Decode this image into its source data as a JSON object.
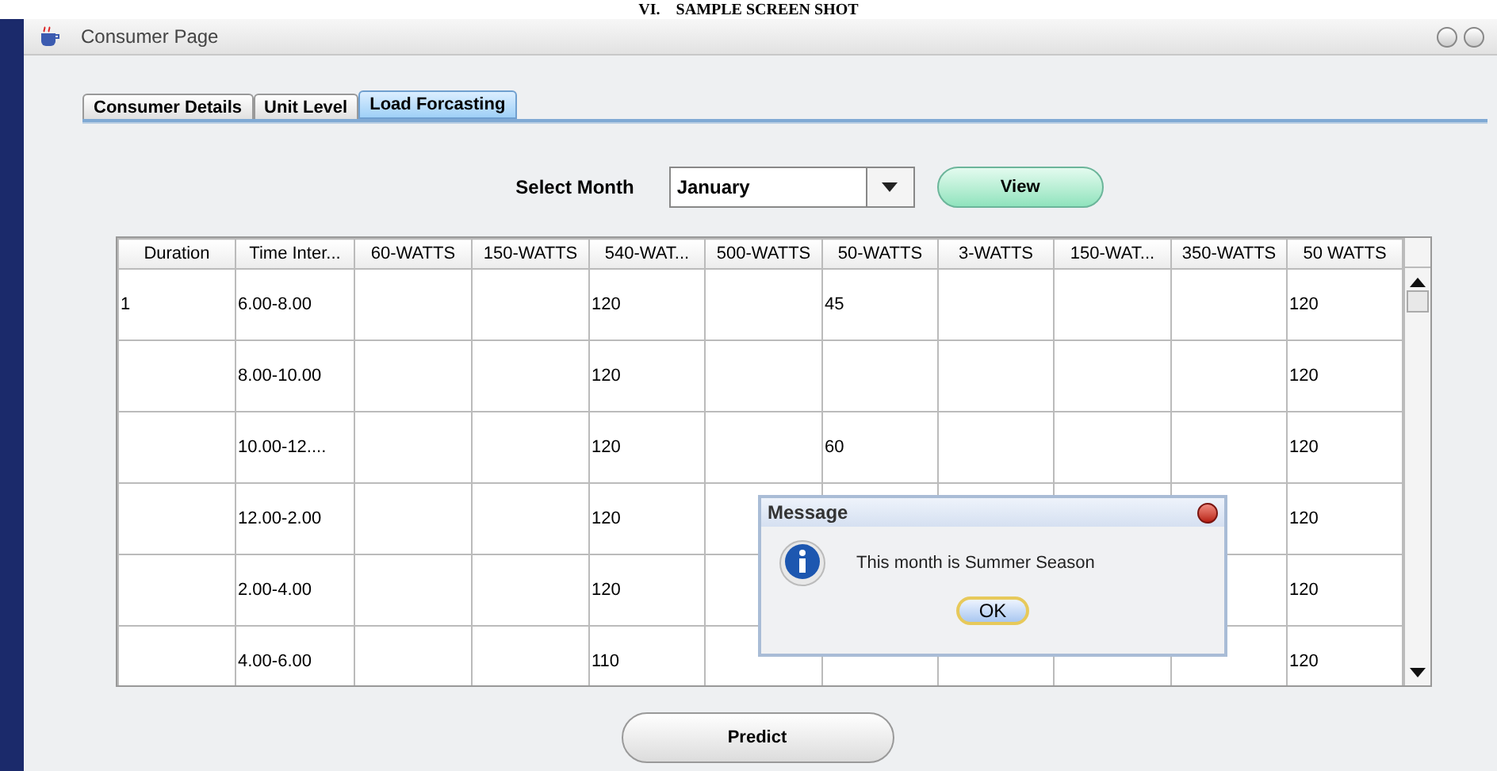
{
  "heading": "VI.    SAMPLE SCREEN SHOT",
  "window": {
    "title": "Consumer Page"
  },
  "tabs": [
    {
      "label": "Consumer Details",
      "selected": false
    },
    {
      "label": "Unit Level",
      "selected": false
    },
    {
      "label": "Load Forcasting",
      "selected": true
    }
  ],
  "month_label": "Select Month",
  "month_select": {
    "value": "January"
  },
  "view_button": "View",
  "table": {
    "columns": [
      "Duration",
      "Time Inter...",
      "60-WATTS",
      "150-WATTS",
      "540-WAT...",
      "500-WATTS",
      "50-WATTS",
      "3-WATTS",
      "150-WAT...",
      "350-WATTS",
      "50 WATTS"
    ],
    "rows": [
      [
        "1",
        "6.00-8.00",
        null,
        null,
        "120",
        null,
        "45",
        null,
        null,
        null,
        "120"
      ],
      [
        null,
        "8.00-10.00",
        null,
        null,
        "120",
        null,
        null,
        null,
        null,
        null,
        "120"
      ],
      [
        null,
        "10.00-12....",
        null,
        null,
        "120",
        null,
        "60",
        null,
        null,
        null,
        "120"
      ],
      [
        null,
        "12.00-2.00",
        null,
        null,
        "120",
        null,
        null,
        null,
        null,
        null,
        "120"
      ],
      [
        null,
        "2.00-4.00",
        null,
        null,
        "120",
        null,
        null,
        null,
        null,
        null,
        "120"
      ],
      [
        null,
        "4.00-6.00",
        null,
        null,
        "110",
        null,
        null,
        null,
        null,
        null,
        "120"
      ]
    ]
  },
  "predict_button": "Predict",
  "dialog": {
    "title": "Message",
    "message": "This month is Summer Season",
    "ok_button": "OK"
  }
}
